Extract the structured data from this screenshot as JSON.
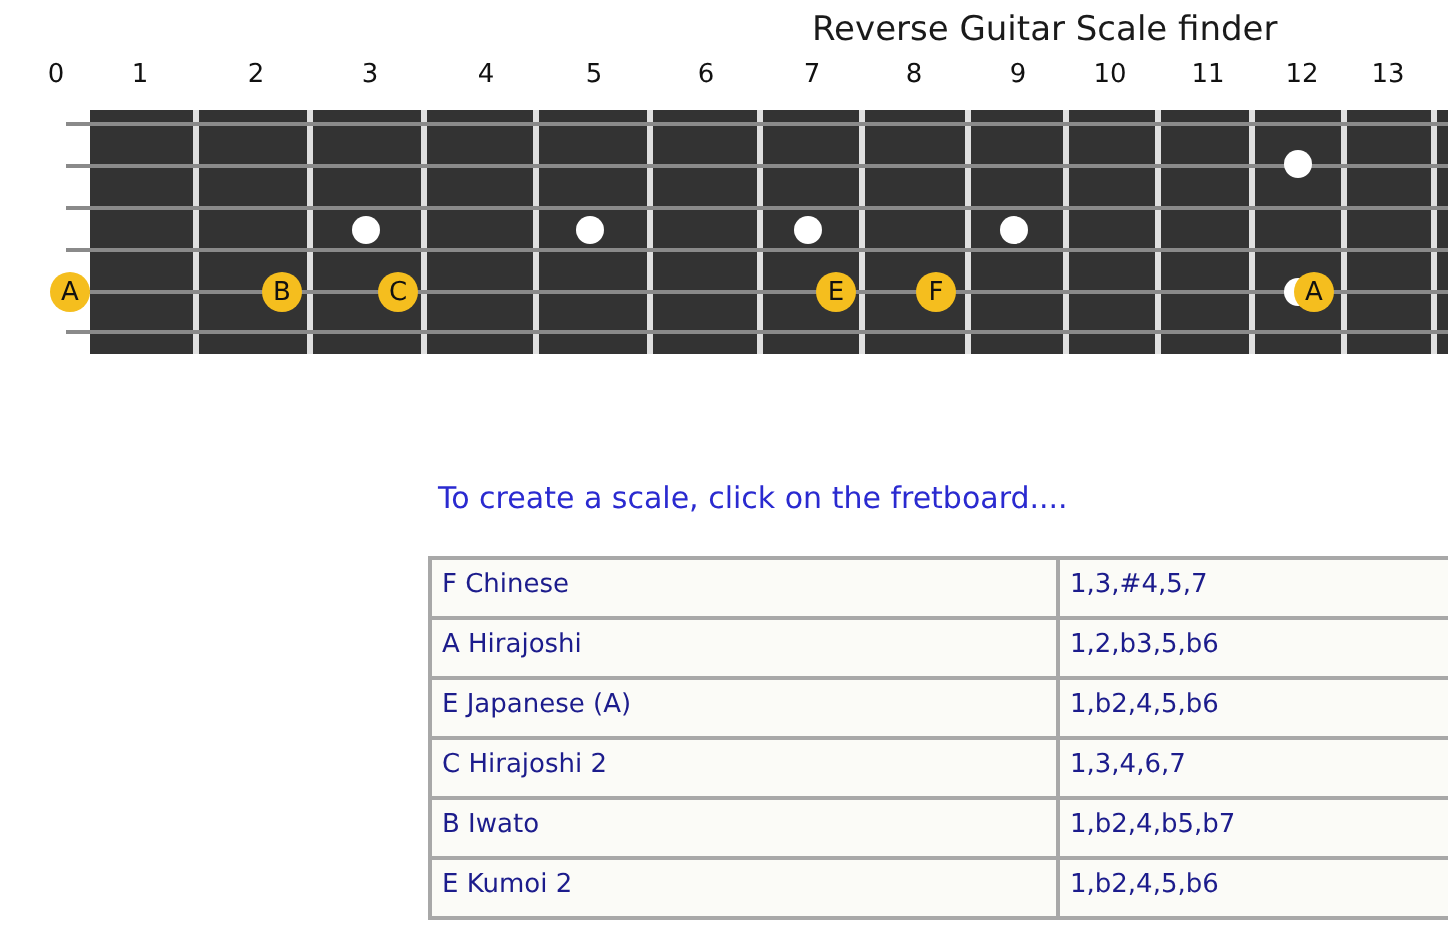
{
  "title": "Reverse Guitar Scale finder",
  "fretboard": {
    "frets": [
      {
        "number": "0",
        "kind": "plain"
      },
      {
        "number": "1",
        "kind": "plain"
      },
      {
        "number": "2",
        "kind": "plain"
      },
      {
        "number": "3",
        "kind": "dot"
      },
      {
        "number": "4",
        "kind": "plain"
      },
      {
        "number": "5",
        "kind": "dot"
      },
      {
        "number": "6",
        "kind": "plain"
      },
      {
        "number": "7",
        "kind": "dot"
      },
      {
        "number": "8",
        "kind": "plain"
      },
      {
        "number": "9",
        "kind": "dot"
      },
      {
        "number": "10",
        "kind": "plain"
      },
      {
        "number": "11",
        "kind": "plain"
      },
      {
        "number": "12",
        "kind": "twodots"
      },
      {
        "number": "13",
        "kind": "plain"
      }
    ],
    "strings": [
      {
        "kind": "plain"
      },
      {
        "kind": "plain"
      },
      {
        "kind": "plain"
      },
      {
        "kind": "plain"
      },
      {
        "kind": "noted",
        "positions": [
          {
            "kind": "note",
            "label": "A"
          },
          {
            "kind": "empty"
          },
          {
            "kind": "note",
            "label": "B"
          },
          {
            "kind": "note",
            "label": "C"
          },
          {
            "kind": "empty"
          },
          {
            "kind": "empty"
          },
          {
            "kind": "empty"
          },
          {
            "kind": "note",
            "label": "E"
          },
          {
            "kind": "note",
            "label": "F"
          },
          {
            "kind": "empty"
          },
          {
            "kind": "empty"
          },
          {
            "kind": "empty"
          },
          {
            "kind": "note",
            "label": "A"
          }
        ]
      },
      {
        "kind": "plain"
      }
    ]
  },
  "message": "To create a scale, click on the fretboard....",
  "scales": [
    {
      "name": "F Chinese",
      "formula": "1,3,#4,5,7"
    },
    {
      "name": "A Hirajoshi",
      "formula": "1,2,b3,5,b6"
    },
    {
      "name": "E Japanese (A)",
      "formula": "1,b2,4,5,b6"
    },
    {
      "name": "C Hirajoshi 2",
      "formula": "1,3,4,6,7"
    },
    {
      "name": "B Iwato",
      "formula": "1,b2,4,b5,b7"
    },
    {
      "name": "E Kumoi 2",
      "formula": "1,b2,4,5,b6"
    }
  ]
}
